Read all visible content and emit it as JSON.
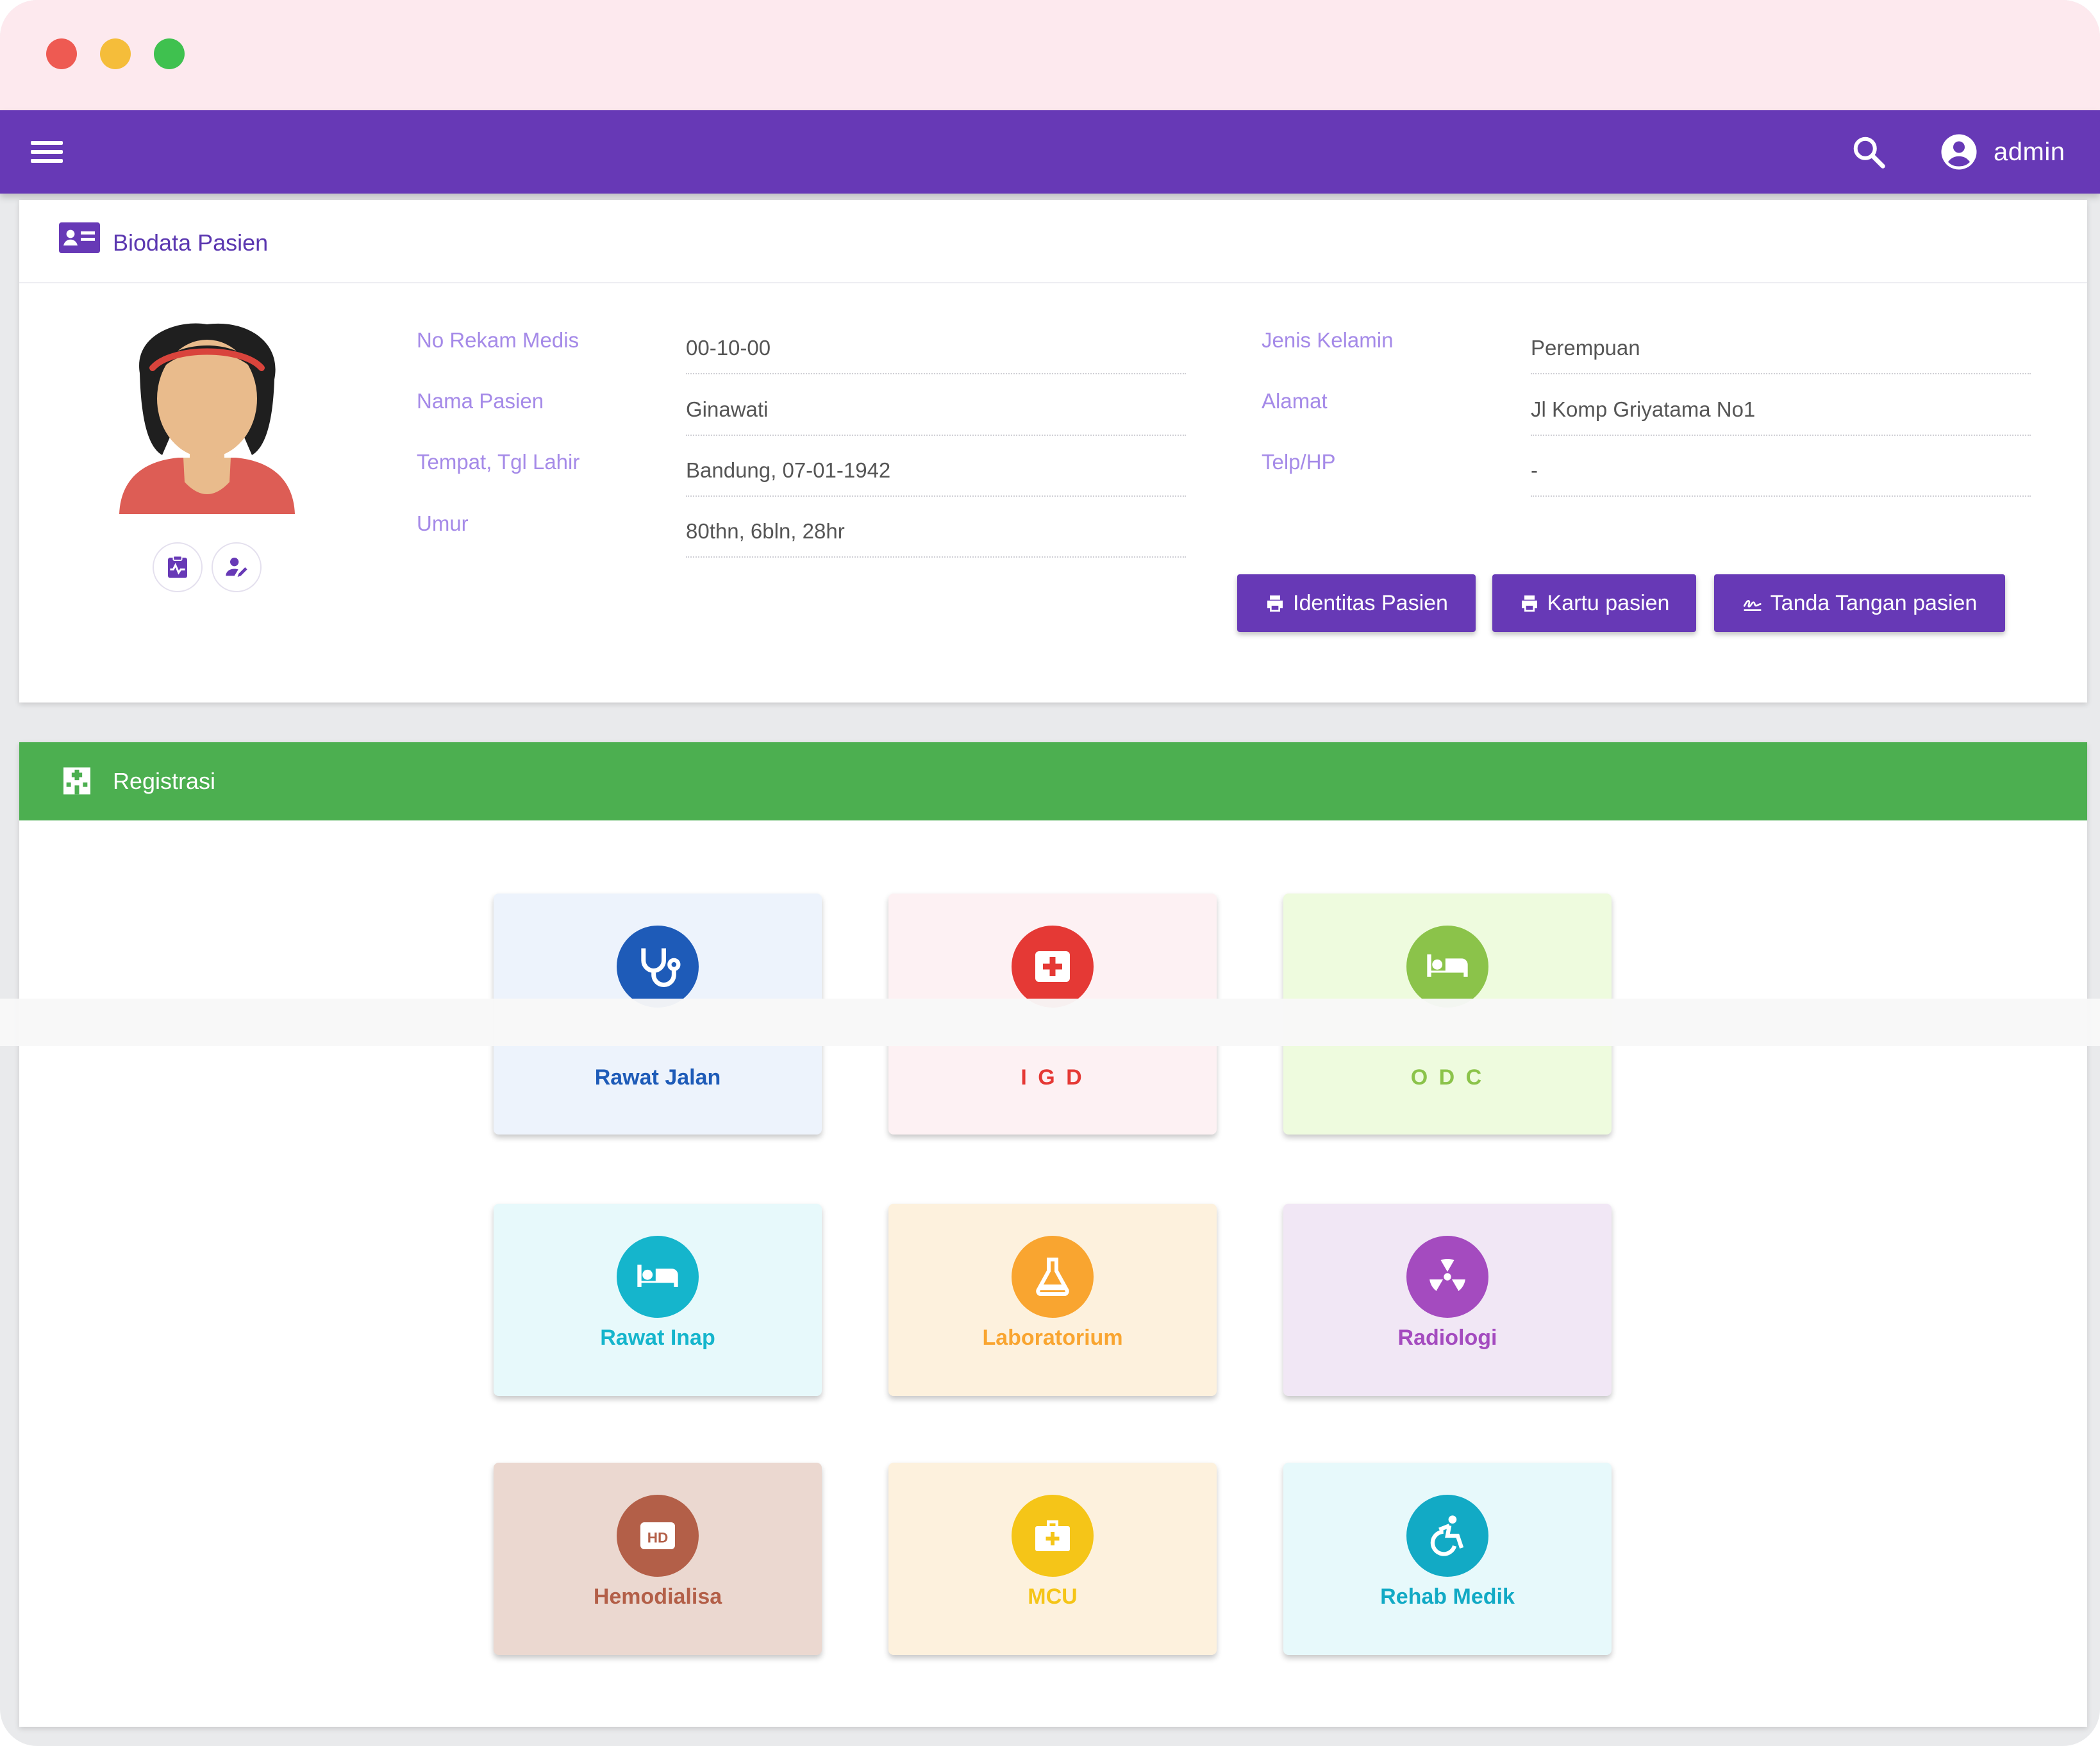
{
  "topbar": {
    "user": "admin"
  },
  "bio": {
    "title": "Biodata Pasien",
    "left": [
      {
        "label": "No Rekam Medis",
        "value": "00-10-00"
      },
      {
        "label": "Nama Pasien",
        "value": "Ginawati"
      },
      {
        "label": "Tempat, Tgl Lahir",
        "value": "Bandung, 07-01-1942"
      },
      {
        "label": "Umur",
        "value": "80thn, 6bln, 28hr"
      }
    ],
    "right": [
      {
        "label": "Jenis Kelamin",
        "value": "Perempuan"
      },
      {
        "label": "Alamat",
        "value": "Jl Komp Griyatama No1"
      },
      {
        "label": "Telp/HP",
        "value": "-"
      }
    ],
    "buttons": {
      "identitas": "Identitas Pasien",
      "kartu": "Kartu pasien",
      "ttd": "Tanda Tangan pasien"
    }
  },
  "registrasi": {
    "title": "Registrasi",
    "tiles": [
      {
        "label": "Rawat Jalan",
        "icon": "stethoscope-icon",
        "bg": "#edf3fc",
        "color": "#1e5bb8"
      },
      {
        "label": "I G D",
        "icon": "first-aid-icon",
        "bg": "#fdf1f3",
        "color": "#e53935"
      },
      {
        "label": "O D C",
        "icon": "hotel-bed-icon",
        "bg": "#eefbde",
        "color": "#8bc34a"
      },
      {
        "label": "Rawat Inap",
        "icon": "hotel-bed-icon",
        "bg": "#e7f9fb",
        "color": "#15b5cc"
      },
      {
        "label": "Laboratorium",
        "icon": "flask-icon",
        "bg": "#fdf1dd",
        "color": "#f9a530"
      },
      {
        "label": "Radiologi",
        "icon": "radiation-icon",
        "bg": "#f1e7f5",
        "color": "#a44bbf"
      },
      {
        "label": "Hemodialisa",
        "icon": "hd-icon",
        "bg": "#ebd8d0",
        "color": "#b35f48"
      },
      {
        "label": "MCU",
        "icon": "medical-bag-icon",
        "bg": "#fdf1dd",
        "color": "#f5c518"
      },
      {
        "label": "Rehab Medik",
        "icon": "accessible-icon",
        "bg": "#e7f9fb",
        "color": "#12aac5"
      }
    ]
  }
}
